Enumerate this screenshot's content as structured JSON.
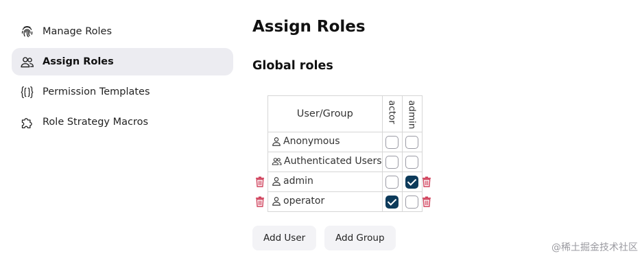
{
  "sidebar": {
    "items": [
      {
        "label": "Manage Roles",
        "icon": "fingerprint-icon"
      },
      {
        "label": "Assign Roles",
        "icon": "users-icon",
        "active": true
      },
      {
        "label": "Permission Templates",
        "icon": "braces-icon"
      },
      {
        "label": "Role Strategy Macros",
        "icon": "puzzle-icon"
      }
    ]
  },
  "main": {
    "title": "Assign Roles",
    "section_title": "Global roles",
    "table": {
      "header_user_group": "User/Group",
      "roles": [
        "actor",
        "admin"
      ],
      "rows": [
        {
          "name": "Anonymous",
          "type": "user",
          "actor": false,
          "admin": false,
          "deletable": false
        },
        {
          "name": "Authenticated Users",
          "type": "group",
          "actor": false,
          "admin": false,
          "deletable": false
        },
        {
          "name": "admin",
          "type": "user",
          "actor": false,
          "admin": true,
          "deletable": true
        },
        {
          "name": "operator",
          "type": "user",
          "actor": true,
          "admin": false,
          "deletable": true
        }
      ]
    },
    "buttons": {
      "add_user": "Add User",
      "add_group": "Add Group"
    }
  },
  "watermark": "@稀土掘金技术社区",
  "colors": {
    "checked": "#0c3a5a",
    "trash": "#d0425c",
    "active_nav_bg": "#ececf1"
  }
}
